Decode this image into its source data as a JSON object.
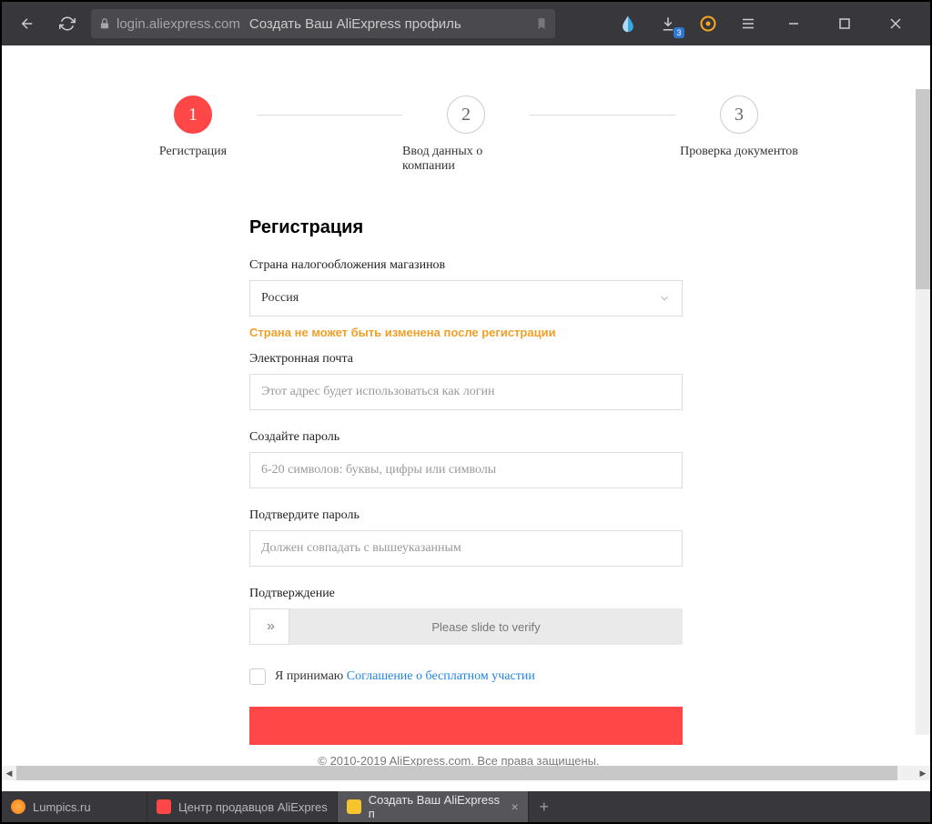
{
  "browser": {
    "url_host": "login.aliexpress.com",
    "page_title": "Создать Ваш AliExpress профиль",
    "download_count": "3"
  },
  "steps": {
    "s1": {
      "num": "1",
      "label": "Регистрация"
    },
    "s2": {
      "num": "2",
      "label": "Ввод данных о компании"
    },
    "s3": {
      "num": "3",
      "label": "Проверка документов"
    }
  },
  "form": {
    "title": "Регистрация",
    "country_label": "Страна налогообложения магазинов",
    "country_value": "Россия",
    "country_warning": "Страна не может быть изменена после регистрации",
    "email_label": "Электронная почта",
    "email_placeholder": "Этот адрес будет использоваться как логин",
    "password_label": "Создайте пароль",
    "password_placeholder": "6-20 символов: буквы, цифры или символы",
    "confirm_label": "Подтвердите пароль",
    "confirm_placeholder": "Должен совпадать с вышеуказанным",
    "captcha_label": "Подтверждение",
    "slider_text": "Please slide to verify",
    "agree_prefix": "Я принимаю ",
    "agree_link": "Соглашение о бесплатном участии"
  },
  "footer": "© 2010-2019 AliExpress.com. Все права защищены.",
  "tabs": {
    "t1": "Lumpics.ru",
    "t2": "Центр продавцов AliExpres",
    "t3": "Создать Ваш AliExpress п"
  }
}
